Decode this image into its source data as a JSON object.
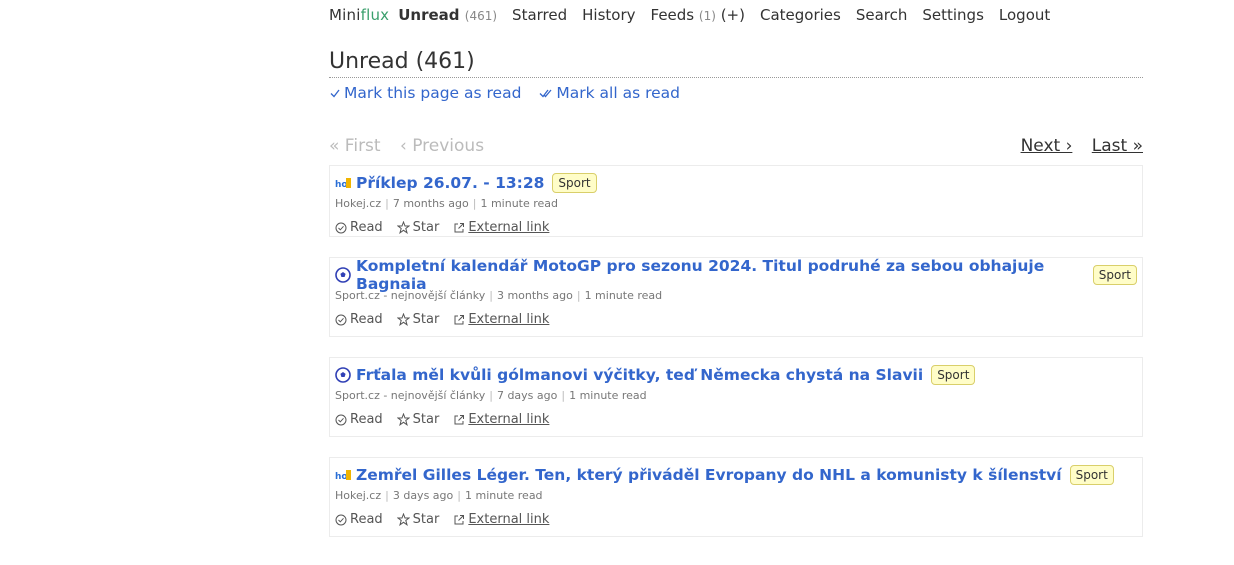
{
  "header": {
    "logo_mini": "Mini",
    "logo_flux": "flux",
    "nav": {
      "unread": "Unread",
      "unread_count": "(461)",
      "starred": "Starred",
      "history": "History",
      "feeds": "Feeds",
      "feeds_count": "(1)",
      "feeds_add": "(+)",
      "categories": "Categories",
      "search": "Search",
      "settings": "Settings",
      "logout": "Logout"
    }
  },
  "page": {
    "title": "Unread (461)",
    "mark_page": "Mark this page as read",
    "mark_all": "Mark all as read"
  },
  "pagination": {
    "first": "« First",
    "previous": "‹ Previous",
    "next": "Next ›",
    "last": "Last »"
  },
  "entry_actions": {
    "read": "Read",
    "star": "Star",
    "external": "External link"
  },
  "entries": [
    {
      "icon": "hokej-icon",
      "title": "Příklep 26.07. - 13:28",
      "category": "Sport",
      "feed": "Hokej.cz",
      "age": "7 months ago",
      "reading_time": "1 minute read"
    },
    {
      "icon": "soccer-ball-icon",
      "title": "Kompletní kalendář MotoGP pro sezonu 2024. Titul podruhé za sebou obhajuje Bagnaia",
      "category": "Sport",
      "feed": "Sport.cz - nejnovější články",
      "age": "3 months ago",
      "reading_time": "1 minute read"
    },
    {
      "icon": "soccer-ball-icon",
      "title": "Frťala měl kvůli gólmanovi výčitky, teď Německa chystá na Slavii",
      "category": "Sport",
      "feed": "Sport.cz - nejnovější články",
      "age": "7 days ago",
      "reading_time": "1 minute read"
    },
    {
      "icon": "hokej-icon",
      "title": "Zemřel Gilles Léger. Ten, který přiváděl Evropany do NHL a komunisty k šílenství",
      "category": "Sport",
      "feed": "Hokej.cz",
      "age": "3 days ago",
      "reading_time": "1 minute read"
    }
  ],
  "colors": {
    "link": "#3366cc",
    "logo_accent": "#3a9f6c",
    "badge_bg": "#fffdc8"
  }
}
